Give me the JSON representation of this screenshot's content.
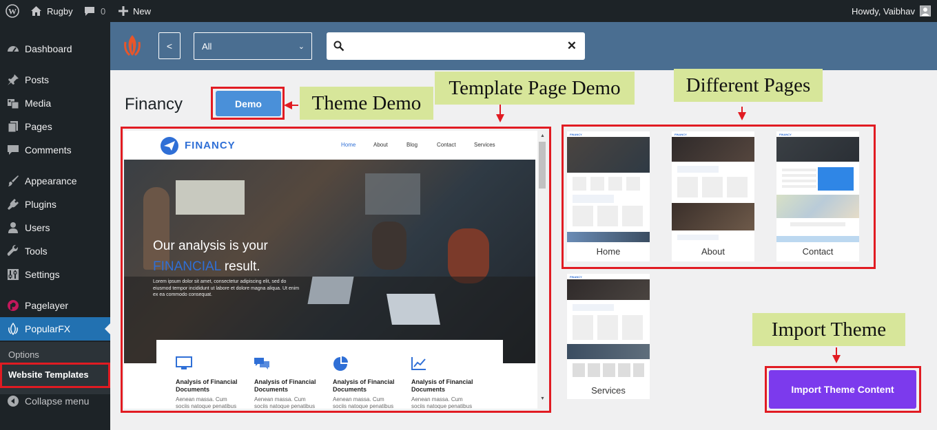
{
  "admin_bar": {
    "site_name": "Rugby",
    "comments_count": "0",
    "new_label": "New",
    "greeting": "Howdy, Vaibhav",
    "icons": [
      "wordpress-icon",
      "home-icon",
      "comment-icon",
      "plus-icon",
      "avatar-icon"
    ]
  },
  "sidebar": {
    "items": [
      {
        "label": "Dashboard",
        "icon": "dashboard-icon"
      },
      {
        "label": "Posts",
        "icon": "pin-icon"
      },
      {
        "label": "Media",
        "icon": "media-icon"
      },
      {
        "label": "Pages",
        "icon": "pages-icon"
      },
      {
        "label": "Comments",
        "icon": "comment-icon"
      },
      {
        "label": "Appearance",
        "icon": "brush-icon"
      },
      {
        "label": "Plugins",
        "icon": "plugin-icon"
      },
      {
        "label": "Users",
        "icon": "user-icon"
      },
      {
        "label": "Tools",
        "icon": "wrench-icon"
      },
      {
        "label": "Settings",
        "icon": "settings-icon"
      },
      {
        "label": "Pagelayer",
        "icon": "pagelayer-icon"
      },
      {
        "label": "PopularFX",
        "icon": "flame-icon"
      }
    ],
    "submenu": [
      {
        "label": "Options"
      },
      {
        "label": "Website Templates"
      }
    ],
    "collapse_label": "Collapse menu"
  },
  "toolbar": {
    "back_label": "<",
    "category_value": "All",
    "search_value": ""
  },
  "template": {
    "title": "Financy",
    "demo_label": "Demo",
    "preview": {
      "brand": "FINANCY",
      "nav": [
        "Home",
        "About",
        "Blog",
        "Contact",
        "Services"
      ],
      "headline_1": "Our analysis is your",
      "headline_2a": "FINANCIAL",
      "headline_2b": " result.",
      "body_text": "Lorem ipsum dolor sit amet, consectetur adipiscing elit, sed do eiusmod tempor incididunt ut labore et dolore magna aliqua. Ut enim ex ea commodo consequat.",
      "cards": [
        {
          "title": "Analysis of Financial Documents",
          "text": "Aenean massa. Cum sociis natoque penatibus magnis"
        },
        {
          "title": "Analysis of Financial Documents",
          "text": "Aenean massa. Cum sociis natoque penatibus magnis"
        },
        {
          "title": "Analysis of Financial Documents",
          "text": "Aenean massa. Cum sociis natoque penatibus magnis"
        },
        {
          "title": "Analysis of Financial Documents",
          "text": "Aenean massa. Cum sociis natoque penatibus magnis"
        }
      ]
    },
    "pages": [
      "Home",
      "About",
      "Contact",
      "Services"
    ],
    "import_label": "Import Theme Content"
  },
  "annotations": {
    "theme_demo": "Theme Demo",
    "template_page_demo": "Template Page Demo",
    "different_pages": "Different Pages",
    "import_theme": "Import Theme"
  },
  "colors": {
    "toolbar": "#4a6e91",
    "sidebar": "#1d2327",
    "active_menu": "#2271b1",
    "demo_button": "#4a90d9",
    "import_button": "#7c3aed",
    "highlight_box": "#e11b22",
    "callout_bg": "#d7e69a"
  }
}
